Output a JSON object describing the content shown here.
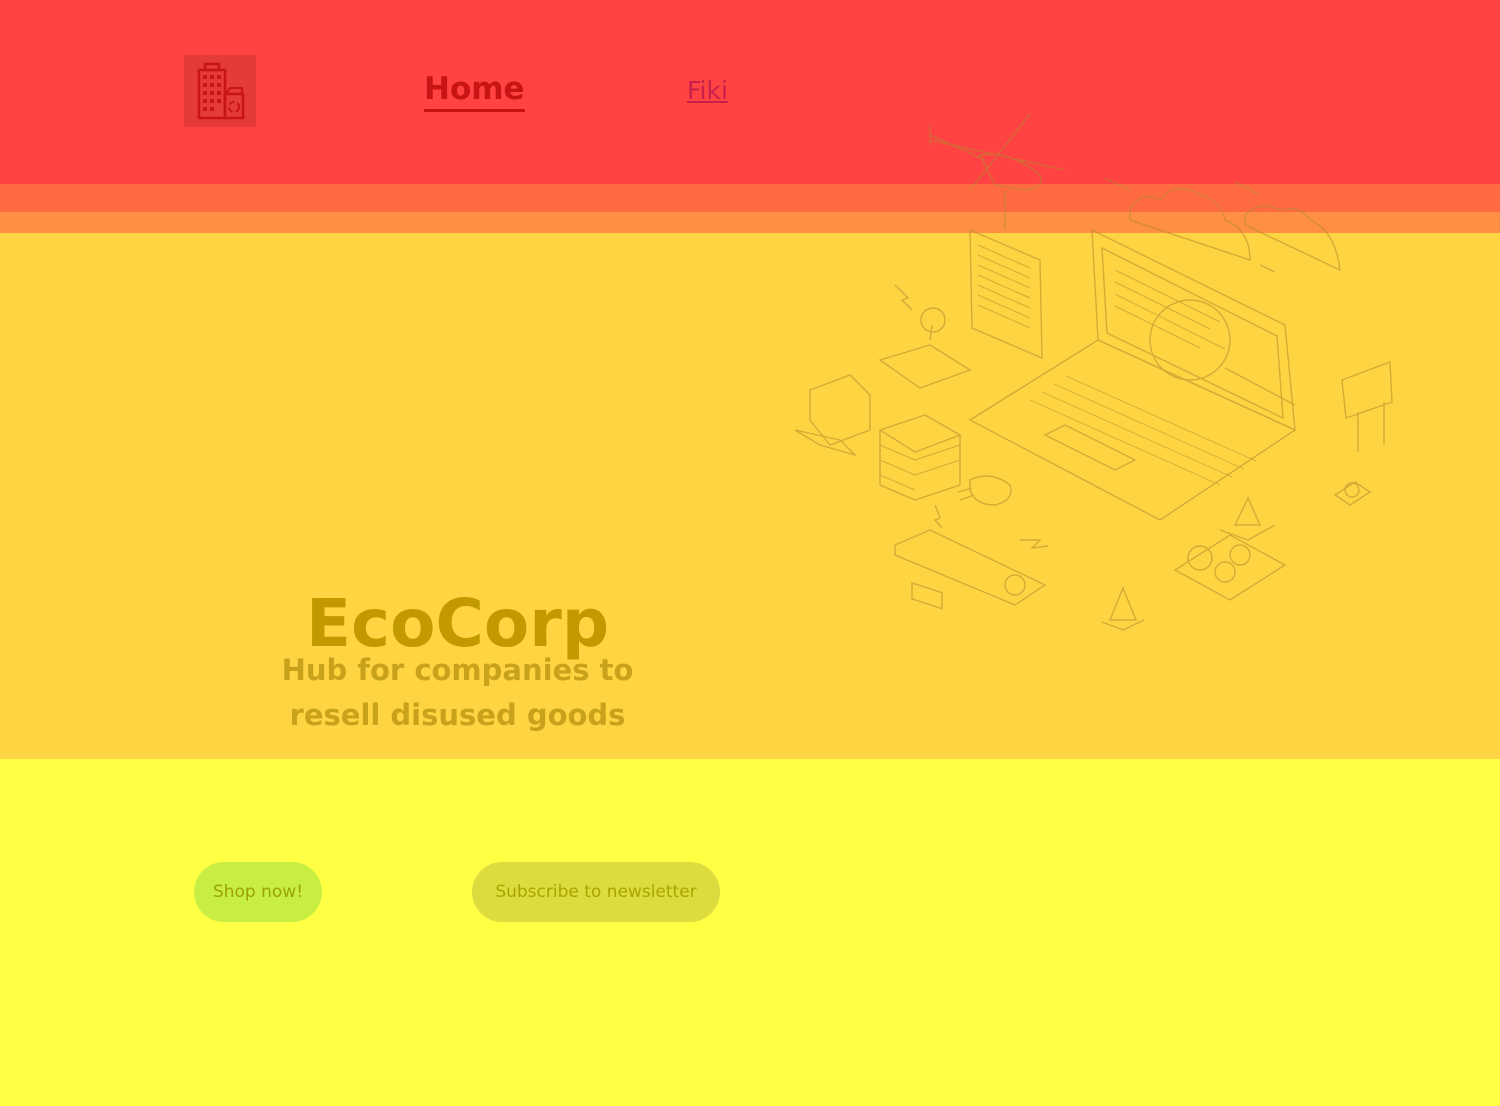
{
  "nav": {
    "logo_icon": "building-recycle-icon",
    "home_label": "Home",
    "fiki_label": "Fiki"
  },
  "hero": {
    "title": "EcoCorp",
    "subtitle": "Hub for companies to resell disused goods",
    "illustration": "isometric-tech-illustration"
  },
  "actions": {
    "shop_label": "Shop now!",
    "subscribe_label": "Subscribe to newsletter"
  },
  "colors": {
    "header_band": "#ff4343",
    "hero_band": "#ffd443",
    "footer_band": "#ffff44",
    "accent_red": "#c81414"
  }
}
